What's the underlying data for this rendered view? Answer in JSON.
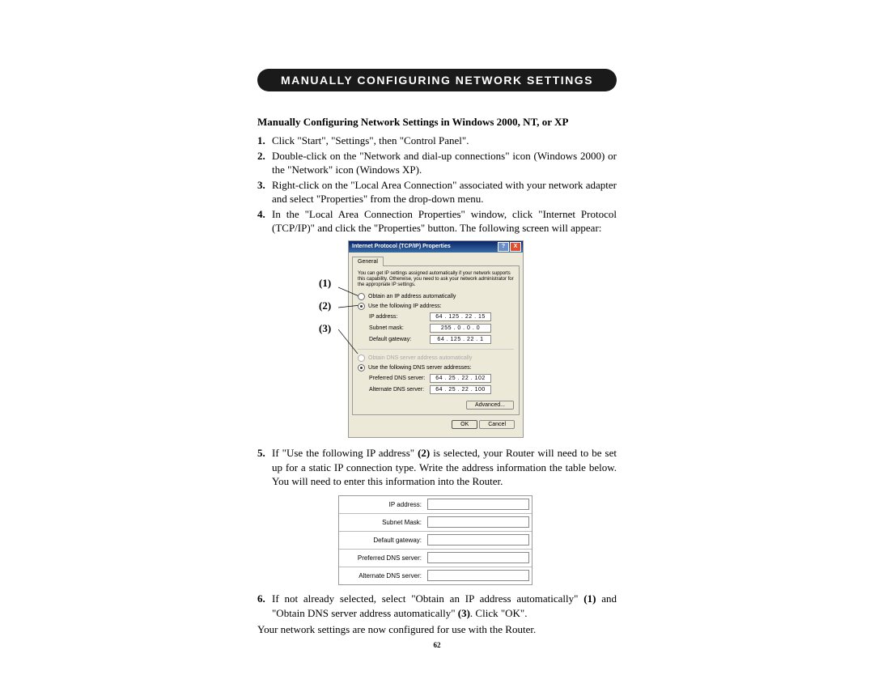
{
  "header": "MANUALLY CONFIGURING NETWORK SETTINGS",
  "subtitle": "Manually Configuring Network Settings in Windows 2000, NT, or XP",
  "steps": {
    "s1": "Click \"Start\", \"Settings\", then \"Control Panel\".",
    "s2": "Double-click on the \"Network and dial-up connections\" icon (Windows 2000) or the \"Network\" icon (Windows XP).",
    "s3": "Right-click on the \"Local Area Connection\" associated with your network adapter and select \"Properties\" from the drop-down menu.",
    "s4": "In the \"Local Area Connection Properties\" window, click \"Internet Protocol (TCP/IP)\" and click the \"Properties\" button. The following screen will appear:",
    "s5a": "If \"Use the following IP address\" ",
    "s5b": "(2)",
    "s5c": " is selected, your Router will need to be set up for a static IP connection type. Write the address information the table below. You will need to enter this information into the Router.",
    "s6a": "If not already selected, select \"Obtain an IP address automatically\" ",
    "s6b": "(1)",
    "s6c": " and \"Obtain DNS server address automatically\" ",
    "s6d": "(3)",
    "s6e": ". Click \"OK\"."
  },
  "callouts": {
    "c1": "(1)",
    "c2": "(2)",
    "c3": "(3)"
  },
  "dialog": {
    "title": "Internet Protocol (TCP/IP) Properties",
    "tab": "General",
    "intro": "You can get IP settings assigned automatically if your network supports this capability. Otherwise, you need to ask your network administrator for the appropriate IP settings.",
    "r1": "Obtain an IP address automatically",
    "r2": "Use the following IP address:",
    "ip_label": "IP address:",
    "ip_val": "64 . 125 . 22 . 15",
    "mask_label": "Subnet mask:",
    "mask_val": "255 .  0  .  0  .  0",
    "gw_label": "Default gateway:",
    "gw_val": "64 . 125 . 22 .  1",
    "r3": "Obtain DNS server address automatically",
    "r4": "Use the following DNS server addresses:",
    "pdns_label": "Preferred DNS server:",
    "pdns_val": "64 .  25 . 22 . 102",
    "adns_label": "Alternate DNS server:",
    "adns_val": "64 .  25 . 22 . 100",
    "advanced": "Advanced...",
    "ok": "OK",
    "cancel": "Cancel"
  },
  "worksheet": {
    "ip": "IP address:",
    "mask": "Subnet Mask:",
    "gw": "Default gateway:",
    "pdns": "Preferred DNS server:",
    "adns": "Alternate DNS server:"
  },
  "footer": "Your network settings are now configured for use with the Router.",
  "page_num": "62"
}
